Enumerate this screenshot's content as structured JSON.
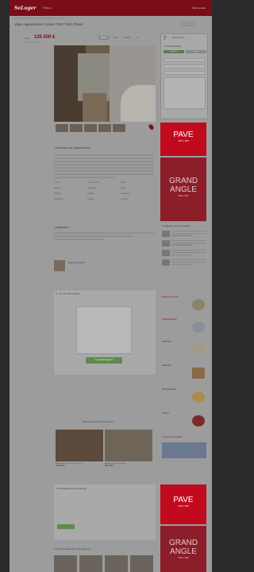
{
  "header": {
    "logo": "SeLoger",
    "menu": "☰ Menu",
    "account": "Mon compte"
  },
  "breadcrumb": "Accueil › Achat › Appartement › Paris 17ème › Paris Plaine",
  "listing": {
    "title": "Vager appartement 1 pièce 75m² Paris Plaine",
    "price_label": "Vente",
    "price": "135 000 €",
    "price_sub": "Honoraires inclus",
    "tabs": [
      "Photos",
      "Vidéo",
      "Quartier",
      "★"
    ],
    "description_title": "L'Exécution de l'appartement",
    "features": [
      "1 pièce",
      "Surface 75 m²",
      "Balcon",
      "Étage 2",
      "Ascenseur",
      "Cave",
      "Parking",
      "Gardien",
      "Interphone",
      "Chauffage",
      "Cuisine",
      "Terrasse"
    ],
    "location_title": "Localisation",
    "agent_name": "Agence contact",
    "calc_title": "2 - Je suis intéressé(e)",
    "calc_button": "Je contacte l'agence",
    "similar_title": "Vous en pourriez aussi aimer...",
    "cards": [
      {
        "title": "Appartement 2 pièces 75m² Paris",
        "price": "350 000 €"
      },
      {
        "title": "Appartement 2 pièces Paris",
        "price": "380 000 €"
      }
    ],
    "loan_title": "3 Simulateur de financement",
    "other_title": "3 Voir les autres biens de l'agence"
  },
  "sidebar": {
    "agency_logo": "7",
    "agency_name": "Agence Immo",
    "contact_label": "Je suis intéressé(e)",
    "phone_label": "Téléphone",
    "email_label": "E-mail",
    "send_label": "Contacter l'agence",
    "related_title": "Les biens en vente à proximité",
    "promos": [
      "Estimez votre bien",
      "Crédit immobilier",
      "Assurance",
      "Diagnostic",
      "Déménagement",
      "Travaux",
      "Les prix de l'immobilier"
    ]
  },
  "ads": [
    {
      "big": "PAVE",
      "dim": "300 x 250"
    },
    {
      "big": "GRAND ANGLE",
      "dim": "300 x 600"
    },
    {
      "big": "PAVE",
      "dim": "300 x 250"
    },
    {
      "big": "GRAND ANGLE",
      "dim": "300 x 600"
    }
  ],
  "colors": {
    "brand": "#c20a1e",
    "topbar": "#7a0d18",
    "action": "#5f8a4e"
  }
}
